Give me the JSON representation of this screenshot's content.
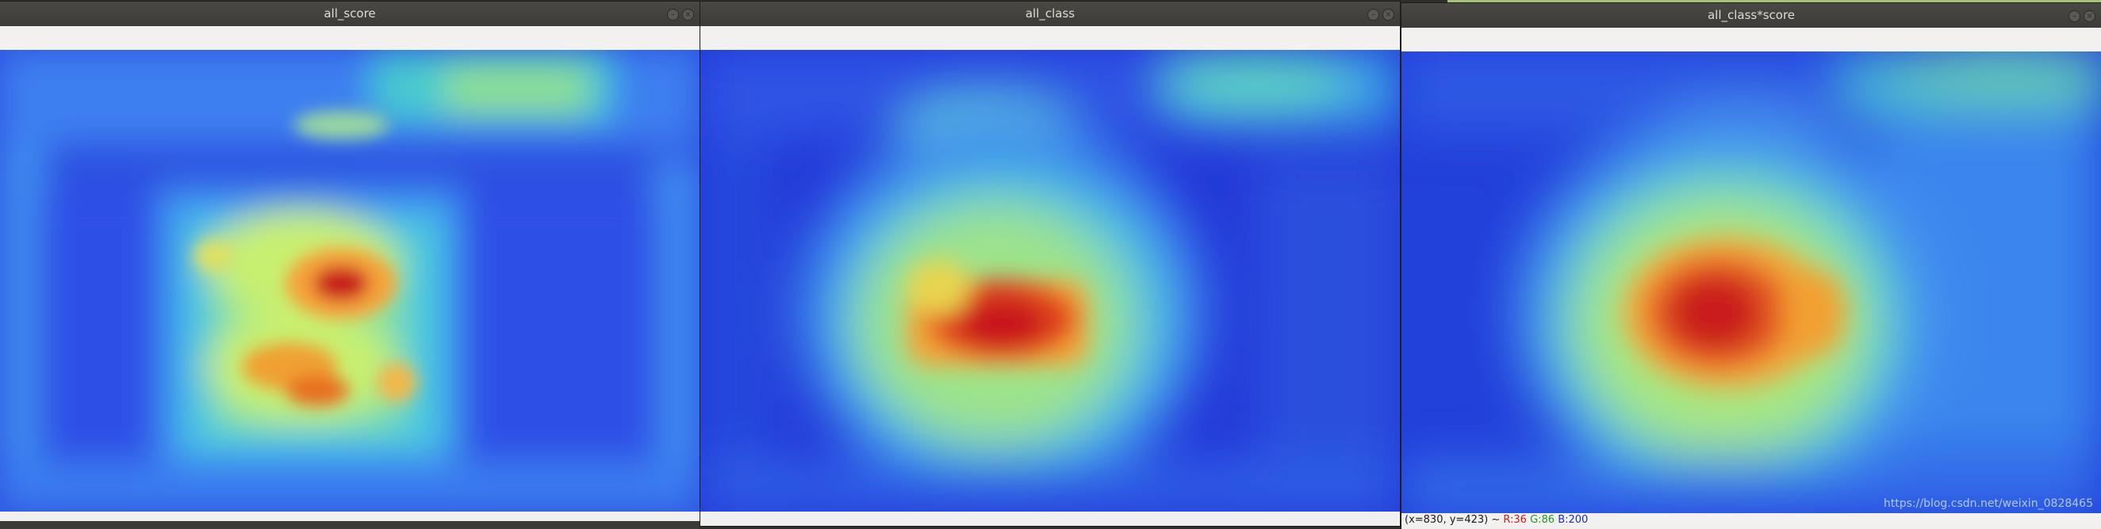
{
  "windows": [
    {
      "title": "all_score",
      "close_glyph": "×",
      "min_glyph": "–",
      "heatmap": "all_score"
    },
    {
      "title": "all_class",
      "close_glyph": "×",
      "min_glyph": "–",
      "heatmap": "all_class"
    },
    {
      "title": "all_class*score",
      "close_glyph": "×",
      "min_glyph": "–",
      "heatmap": "all_class_score",
      "status": {
        "coords": "(x=830, y=423) ~",
        "r": "R:36",
        "g": "G:86",
        "b": "B:200"
      },
      "watermark": "https://blog.csdn.net/weixin_0828465"
    }
  ],
  "colors": {
    "jet_low": "#1a2fd6",
    "jet_mid": "#3fd9c8",
    "jet_high": "#d7191c"
  },
  "icons": [
    "minimize-icon",
    "close-icon"
  ]
}
